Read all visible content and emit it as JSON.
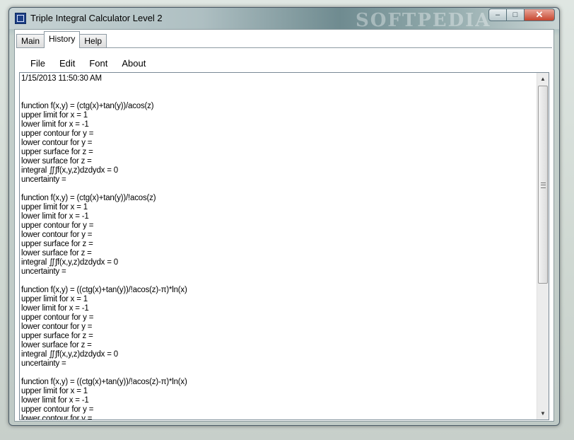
{
  "window": {
    "title": "Triple Integral Calculator Level 2",
    "watermark": "SOFTPEDIA",
    "watermark_small": "SOFTPEDIA",
    "controls": {
      "minimize": "–",
      "maximize": "□",
      "close": "✕"
    }
  },
  "tabs": [
    {
      "label": "Main"
    },
    {
      "label": "History"
    },
    {
      "label": "Help"
    }
  ],
  "menu": [
    {
      "label": "File"
    },
    {
      "label": "Edit"
    },
    {
      "label": "Font"
    },
    {
      "label": "About"
    }
  ],
  "history_text": "1/15/2013 11:50:30 AM\n\n\nfunction f(x,y) = (ctg(x)+tan(y))/acos(z)\nupper limit for x = 1\nlower limit for x = -1\nupper contour for y =\nlower contour for y =\nupper surface for z =\nlower surface for z =\nintegral ∬∫f(x,y,z)dzdydx = 0\nuncertainty =\n\nfunction f(x,y) = (ctg(x)+tan(y))/!acos(z)\nupper limit for x = 1\nlower limit for x = -1\nupper contour for y =\nlower contour for y =\nupper surface for z =\nlower surface for z =\nintegral ∬∫f(x,y,z)dzdydx = 0\nuncertainty =\n\nfunction f(x,y) = ((ctg(x)+tan(y))/!acos(z)-π)*ln(x)\nupper limit for x = 1\nlower limit for x = -1\nupper contour for y =\nlower contour for y =\nupper surface for z =\nlower surface for z =\nintegral ∬∫f(x,y,z)dzdydx = 0\nuncertainty =\n\nfunction f(x,y) = ((ctg(x)+tan(y))/!acos(z)-π)*ln(x)\nupper limit for x = 1\nlower limit for x = -1\nupper contour for y =\nlower contour for y =",
  "scrollbar": {
    "up": "▲",
    "down": "▼"
  }
}
